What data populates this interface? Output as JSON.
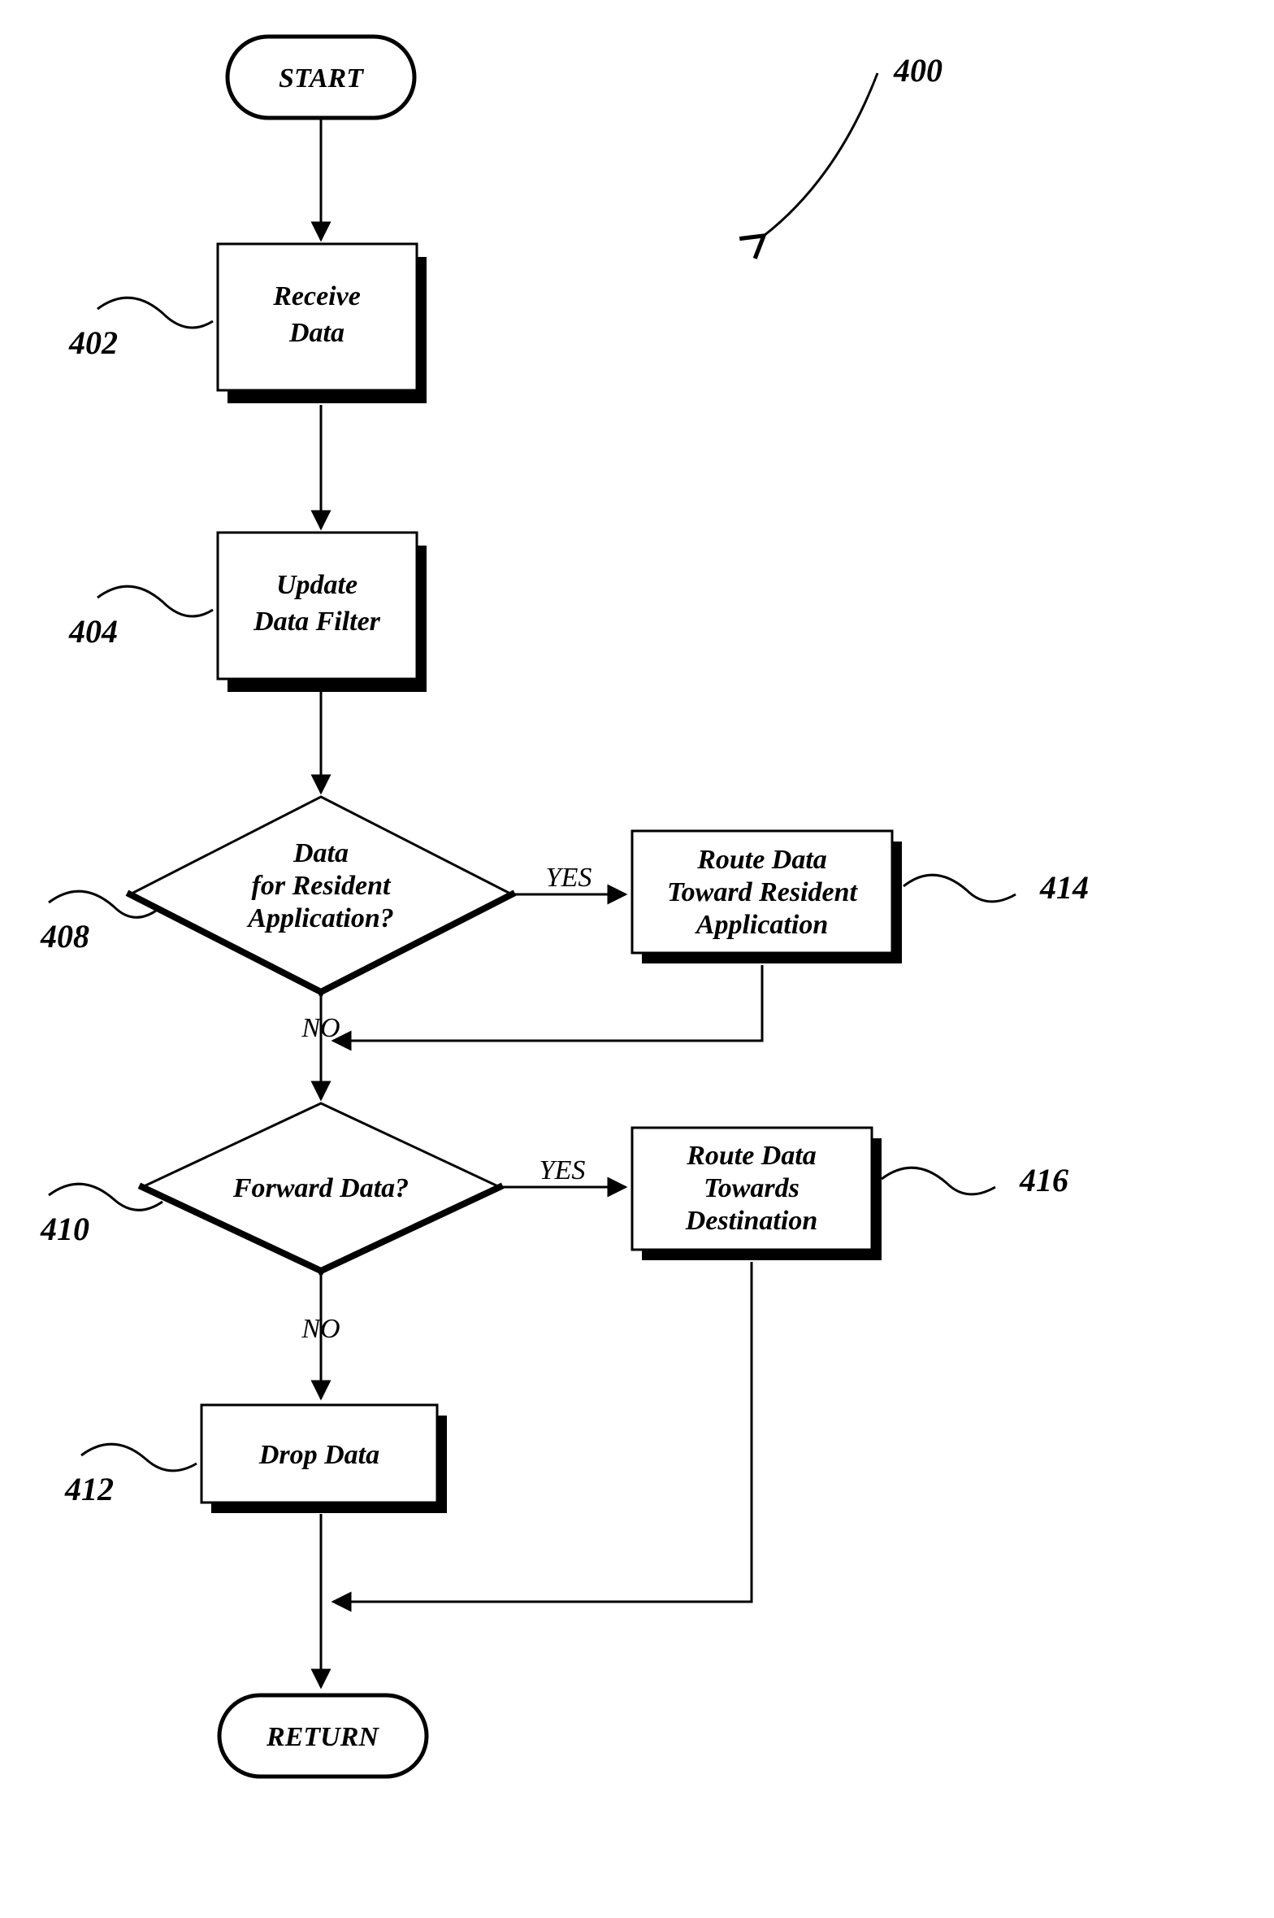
{
  "figure_ref": "400",
  "nodes": {
    "start": {
      "label": "START"
    },
    "receive": {
      "ref": "402",
      "lines": [
        "Receive",
        "Data"
      ]
    },
    "update": {
      "ref": "404",
      "lines": [
        "Update",
        "Data Filter"
      ]
    },
    "decision1": {
      "ref": "408",
      "lines": [
        "Data",
        "for Resident",
        "Application?"
      ]
    },
    "decision2": {
      "ref": "410",
      "lines": [
        "Forward Data?"
      ]
    },
    "route_resident": {
      "ref": "414",
      "lines": [
        "Route Data",
        "Toward Resident",
        "Application"
      ]
    },
    "route_dest": {
      "ref": "416",
      "lines": [
        "Route Data",
        "Towards",
        "Destination"
      ]
    },
    "drop": {
      "ref": "412",
      "lines": [
        "Drop Data"
      ]
    },
    "return_": {
      "label": "RETURN"
    }
  },
  "edges": {
    "yes": "YES",
    "no": "NO"
  }
}
